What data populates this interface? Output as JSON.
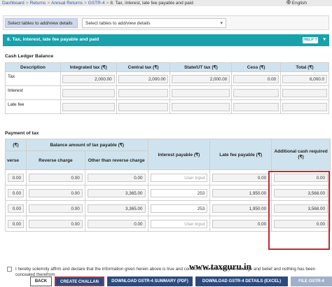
{
  "breadcrumb": {
    "items": [
      "Dashboard",
      "Returns",
      "Annual Returns",
      "GSTR-4",
      "8. Tax, interest, late fee payable and paid"
    ],
    "separator": ">"
  },
  "language": "English",
  "table_selector": {
    "label": "Select tables to add/view details",
    "value": "Select tables to add/view details"
  },
  "section_header": {
    "title": "8. Tax, interest, late fee payable and paid",
    "help_label": "HELP",
    "help_icon": "question-icon"
  },
  "cash_ledger": {
    "title": "Cash Ledger Balance",
    "columns": [
      "Description",
      "Integrated tax (₹)",
      "Central tax (₹)",
      "State/UT tax (₹)",
      "Cess (₹)",
      "Total (₹)"
    ],
    "rows": [
      {
        "label": "Tax",
        "values": [
          "2,000.00",
          "2,000.00",
          "2,000.00",
          "0.00",
          "6,000.0"
        ]
      },
      {
        "label": "Interest",
        "values": [
          "",
          "",
          "",
          "",
          ""
        ]
      },
      {
        "label": "Late fee",
        "values": [
          "",
          "",
          "",
          "",
          ""
        ]
      }
    ]
  },
  "payment_of_tax": {
    "title": "Payment of tax",
    "col_first_top": "(₹)",
    "col_first_sub": "verse",
    "col_balance_group": "Balance amount of tax payable (₹)",
    "col_reverse": "Reverse charge",
    "col_other": "Other than reverse charge",
    "col_interest": "Interest payable (₹)",
    "col_latefee": "Late fee payable (₹)",
    "col_additional": "Additional cash required (₹)",
    "rows": [
      {
        "first": "0.00",
        "reverse": "0.00",
        "other": "0.00",
        "interest": "",
        "interest_placeholder": "User Input",
        "latefee": "0.00",
        "additional": "0.00"
      },
      {
        "first": "0.00",
        "reverse": "0.00",
        "other": "3,365.00",
        "interest": "253",
        "interest_placeholder": "",
        "latefee": "1,950.00",
        "additional": "3,568.00"
      },
      {
        "first": "0.00",
        "reverse": "0.00",
        "other": "3,365.00",
        "interest": "253",
        "interest_placeholder": "",
        "latefee": "1,950.00",
        "additional": "3,568.00"
      },
      {
        "first": "0.00",
        "reverse": "0.00",
        "other": "0.00",
        "interest": "",
        "interest_placeholder": "User Input",
        "latefee": "0.00",
        "additional": "0.00"
      }
    ]
  },
  "watermark": "www.taxguru.in",
  "declaration": "I hereby solemnly affirm and declare that the information given herein above is true and correct to the best of my knowledge and belief and nothing has been concealed therefrom.",
  "buttons": {
    "back": "BACK",
    "create_challan": "CREATE CHALLAN",
    "download_summary": "DOWNLOAD GSTR-4 SUMMARY (PDF)",
    "download_details": "DOWNLOAD GSTR-4 DETAILS (EXCEL)",
    "file": "FILE GSTR-4"
  },
  "colors": {
    "header_teal": "#17a2ac",
    "table_header": "#cfe3ee",
    "button_blue": "#2c4a7e",
    "highlight_red": "#c8282d"
  }
}
